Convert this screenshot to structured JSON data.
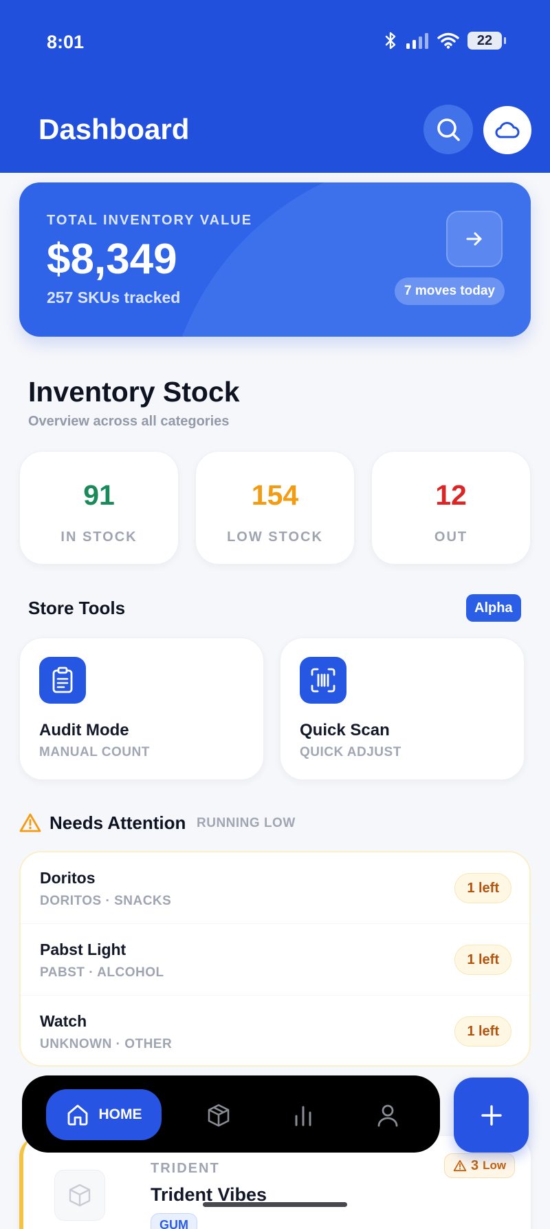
{
  "status_bar": {
    "time": "8:01",
    "battery": "22"
  },
  "header": {
    "title": "Dashboard"
  },
  "hero": {
    "label": "TOTAL INVENTORY VALUE",
    "value": "$8,349",
    "subtitle": "257 SKUs tracked",
    "moves": "7 moves today"
  },
  "inventory": {
    "title": "Inventory Stock",
    "subtitle": "Overview across all categories",
    "stats": [
      {
        "value": "91",
        "label": "IN STOCK",
        "color": "#1a8a5a"
      },
      {
        "value": "154",
        "label": "LOW STOCK",
        "color": "#f39c12"
      },
      {
        "value": "12",
        "label": "OUT",
        "color": "#dc2626"
      }
    ]
  },
  "tools": {
    "title": "Store Tools",
    "badge": "Alpha",
    "items": [
      {
        "name": "Audit Mode",
        "sub": "MANUAL COUNT",
        "icon": "clipboard-icon"
      },
      {
        "name": "Quick Scan",
        "sub": "QUICK ADJUST",
        "icon": "barcode-scan-icon"
      }
    ]
  },
  "attention": {
    "title": "Needs Attention",
    "tag": "RUNNING LOW",
    "items": [
      {
        "name": "Doritos",
        "meta": "DORITOS · SNACKS",
        "count": "1 left"
      },
      {
        "name": "Pabst Light",
        "meta": "PABST · ALCOHOL",
        "count": "1 left"
      },
      {
        "name": "Watch",
        "meta": "UNKNOWN · OTHER",
        "count": "1 left"
      }
    ]
  },
  "product_peek": {
    "brand": "TRIDENT",
    "name": "Trident Vibes",
    "tag": "GUM",
    "low_count": "3",
    "low_word": "Low"
  },
  "nav": {
    "home_label": "HOME",
    "items": [
      "home-icon",
      "box-icon",
      "chart-icon",
      "profile-icon"
    ]
  },
  "colors": {
    "brand": "#2150dd",
    "accent": "#2754e2"
  }
}
